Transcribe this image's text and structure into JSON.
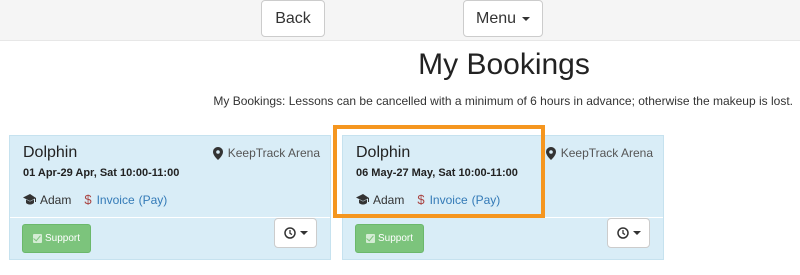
{
  "nav": {
    "back_label": "Back",
    "menu_label": "Menu"
  },
  "page": {
    "title": "My Bookings",
    "note": "My Bookings: Lessons can be cancelled with a minimum of 6 hours in advance; otherwise the makeup is lost."
  },
  "bookings": [
    {
      "lesson": "Dolphin",
      "location": "KeepTrack Arena",
      "dates": "01 Apr-29 Apr, Sat 10:00-11:00",
      "teacher": "Adam",
      "invoice_label": "Invoice",
      "pay_label": "(Pay)",
      "support_label": "Support"
    },
    {
      "lesson": "Dolphin",
      "location": "KeepTrack Arena",
      "dates": "06 May-27 May, Sat 10:00-11:00",
      "teacher": "Adam",
      "invoice_label": "Invoice",
      "pay_label": "(Pay)",
      "support_label": "Support"
    }
  ],
  "icons": {
    "location": "map-marker-icon",
    "teacher": "graduation-cap-icon",
    "invoice": "dollar-icon",
    "actions": "clock-icon"
  },
  "colors": {
    "card_bg": "#d9edf7",
    "link": "#337ab7",
    "support_button": "#7cc47c",
    "dollar": "#a94442",
    "highlight": "#f5961f"
  }
}
